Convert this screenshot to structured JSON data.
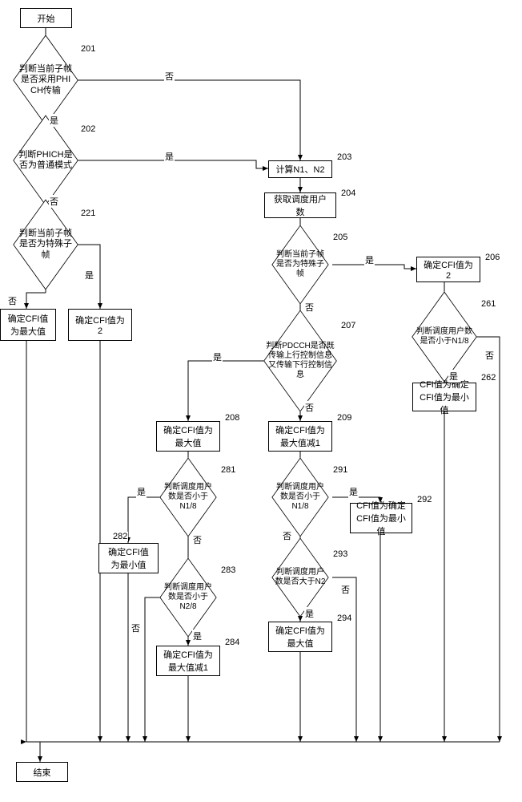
{
  "chart_data": {
    "type": "flowchart",
    "title": "",
    "nodes": [
      {
        "id": "start",
        "type": "terminator",
        "text": "开始"
      },
      {
        "id": "201",
        "type": "decision",
        "step": "201",
        "text": "判断当前子帧是否采用PHI CH传输"
      },
      {
        "id": "202",
        "type": "decision",
        "step": "202",
        "text": "判断PHICH是否为普通模式"
      },
      {
        "id": "203",
        "type": "process",
        "step": "203",
        "text": "计算N1、N2"
      },
      {
        "id": "204",
        "type": "process",
        "step": "204",
        "text": "获取调度用户数"
      },
      {
        "id": "221",
        "type": "decision",
        "step": "221",
        "text": "判断当前子帧是否为特殊子帧"
      },
      {
        "id": "221a",
        "type": "process",
        "text": "确定CFI值为最大值"
      },
      {
        "id": "221b",
        "type": "process",
        "text": "确定CFI值为2"
      },
      {
        "id": "205",
        "type": "decision",
        "step": "205",
        "text": "判断当前子帧是否为特殊子帧"
      },
      {
        "id": "206",
        "type": "process",
        "step": "206",
        "text": "确定CFI值为2"
      },
      {
        "id": "261",
        "type": "decision",
        "step": "261",
        "text": "判断调度用户数是否小于N1/8"
      },
      {
        "id": "262",
        "type": "process",
        "step": "262",
        "text": "CFI值为确定CFI值为最小值"
      },
      {
        "id": "207",
        "type": "decision",
        "step": "207",
        "text": "判断PDCCH是否既传输上行控制信息又传输下行控制信息"
      },
      {
        "id": "208",
        "type": "process",
        "step": "208",
        "text": "确定CFI值为最大值"
      },
      {
        "id": "209",
        "type": "process",
        "step": "209",
        "text": "确定CFI值为最大值减1"
      },
      {
        "id": "281",
        "type": "decision",
        "step": "281",
        "text": "判断调度用户数是否小于N1/8"
      },
      {
        "id": "282",
        "type": "process",
        "step": "282",
        "text": "确定CFI值为最小值"
      },
      {
        "id": "283",
        "type": "decision",
        "step": "283",
        "text": "判断调度用户数是否小于N2/8"
      },
      {
        "id": "284",
        "type": "process",
        "step": "284",
        "text": "确定CFI值为最大值减1"
      },
      {
        "id": "291",
        "type": "decision",
        "step": "291",
        "text": "判断调度用户数是否小于N1/8"
      },
      {
        "id": "292",
        "type": "process",
        "step": "292",
        "text": "CFI值为确定CFI值为最小值"
      },
      {
        "id": "293",
        "type": "decision",
        "step": "293",
        "text": "判断调度用户数是否大于N2"
      },
      {
        "id": "294",
        "type": "process",
        "step": "294",
        "text": "确定CFI值为最大值"
      },
      {
        "id": "end",
        "type": "terminator",
        "text": "结束"
      }
    ],
    "edges": [
      {
        "from": "start",
        "to": "201"
      },
      {
        "from": "201",
        "to": "202",
        "label": "是"
      },
      {
        "from": "201",
        "to": "203",
        "label": "否"
      },
      {
        "from": "202",
        "to": "221",
        "label": "否"
      },
      {
        "from": "202",
        "to": "203",
        "label": "是"
      },
      {
        "from": "203",
        "to": "204"
      },
      {
        "from": "204",
        "to": "205"
      },
      {
        "from": "205",
        "to": "206",
        "label": "是"
      },
      {
        "from": "205",
        "to": "207",
        "label": "否"
      },
      {
        "from": "206",
        "to": "261"
      },
      {
        "from": "261",
        "to": "262",
        "label": "是"
      },
      {
        "from": "261",
        "to": "end",
        "label": "否"
      },
      {
        "from": "262",
        "to": "end"
      },
      {
        "from": "207",
        "to": "208",
        "label": "是"
      },
      {
        "from": "207",
        "to": "209",
        "label": "否"
      },
      {
        "from": "208",
        "to": "281"
      },
      {
        "from": "209",
        "to": "291"
      },
      {
        "from": "221",
        "to": "221a",
        "label": "否"
      },
      {
        "from": "221",
        "to": "221b",
        "label": "是"
      },
      {
        "from": "221a",
        "to": "end"
      },
      {
        "from": "221b",
        "to": "end"
      },
      {
        "from": "281",
        "to": "282",
        "label": "是"
      },
      {
        "from": "281",
        "to": "283",
        "label": "否"
      },
      {
        "from": "282",
        "to": "end"
      },
      {
        "from": "283",
        "to": "284",
        "label": "是"
      },
      {
        "from": "283",
        "to": "end",
        "label": "否"
      },
      {
        "from": "284",
        "to": "end"
      },
      {
        "from": "291",
        "to": "292",
        "label": "是"
      },
      {
        "from": "291",
        "to": "293",
        "label": "否"
      },
      {
        "from": "292",
        "to": "end"
      },
      {
        "from": "293",
        "to": "294",
        "label": "是"
      },
      {
        "from": "293",
        "to": "end",
        "label": "否"
      },
      {
        "from": "294",
        "to": "end"
      }
    ]
  },
  "labels": {
    "yes": "是",
    "no": "否",
    "start": "开始",
    "end": "结束",
    "s201": "判断当前子帧是否采用PHI CH传输",
    "s202": "判断PHICH是否为普通模式",
    "s203": "计算N1、N2",
    "s204": "获取调度用户数",
    "s205": "判断当前子帧是否为特殊子帧",
    "s206": "确定CFI值为2",
    "s207": "判断PDCCH是否既传输上行控制信息又传输下行控制信息",
    "s208": "确定CFI值为最大值",
    "s209": "确定CFI值为最大值减1",
    "s221": "判断当前子帧是否为特殊子帧",
    "s221a": "确定CFI值为最大值",
    "s221b": "确定CFI值为2",
    "s261": "判断调度用户数是否小于N1/8",
    "s262": "CFI值为确定CFI值为最小值",
    "s281": "判断调度用户数是否小于N1/8",
    "s282": "确定CFI值为最小值",
    "s283": "判断调度用户数是否小于N2/8",
    "s284": "确定CFI值为最大值减1",
    "s291": "判断调度用户数是否小于N1/8",
    "s292": "CFI值为确定CFI值为最小值",
    "s293": "判断调度用户数是否大于N2",
    "s294": "确定CFI值为最大值",
    "n201": "201",
    "n202": "202",
    "n203": "203",
    "n204": "204",
    "n205": "205",
    "n206": "206",
    "n207": "207",
    "n208": "208",
    "n209": "209",
    "n221": "221",
    "n261": "261",
    "n262": "262",
    "n281": "281",
    "n282": "282",
    "n283": "283",
    "n284": "284",
    "n291": "291",
    "n292": "292",
    "n293": "293",
    "n294": "294"
  }
}
